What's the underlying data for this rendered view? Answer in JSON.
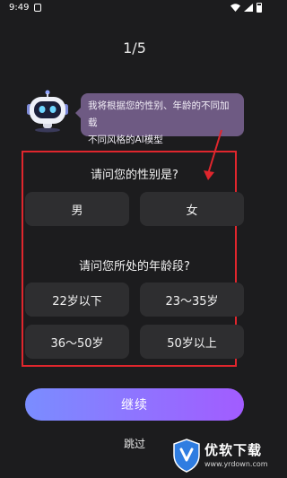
{
  "status_bar": {
    "time": "9:49"
  },
  "progress": {
    "text": "1/5",
    "current": 1,
    "total": 5
  },
  "assistant": {
    "message_line1": "我将根据您的性别、年龄的不同加载",
    "message_line2": "不同风格的AI模型"
  },
  "gender_question": {
    "title": "请问您的性别是?",
    "options": [
      "男",
      "女"
    ]
  },
  "age_question": {
    "title": "请问您所处的年龄段?",
    "options": [
      "22岁以下",
      "23～35岁",
      "36～50岁",
      "50岁以上"
    ]
  },
  "actions": {
    "continue_label": "继续",
    "skip_label": "跳过"
  },
  "watermark": {
    "name": "优软下载",
    "url": "www.yrdown.com"
  },
  "colors": {
    "background": "#1c1c1e",
    "option_bg": "#2e2e30",
    "bubble_bg": "#6e5a83",
    "annotation_red": "#e0262d",
    "gradient_start": "#7a8dff",
    "gradient_end": "#a25cff"
  }
}
